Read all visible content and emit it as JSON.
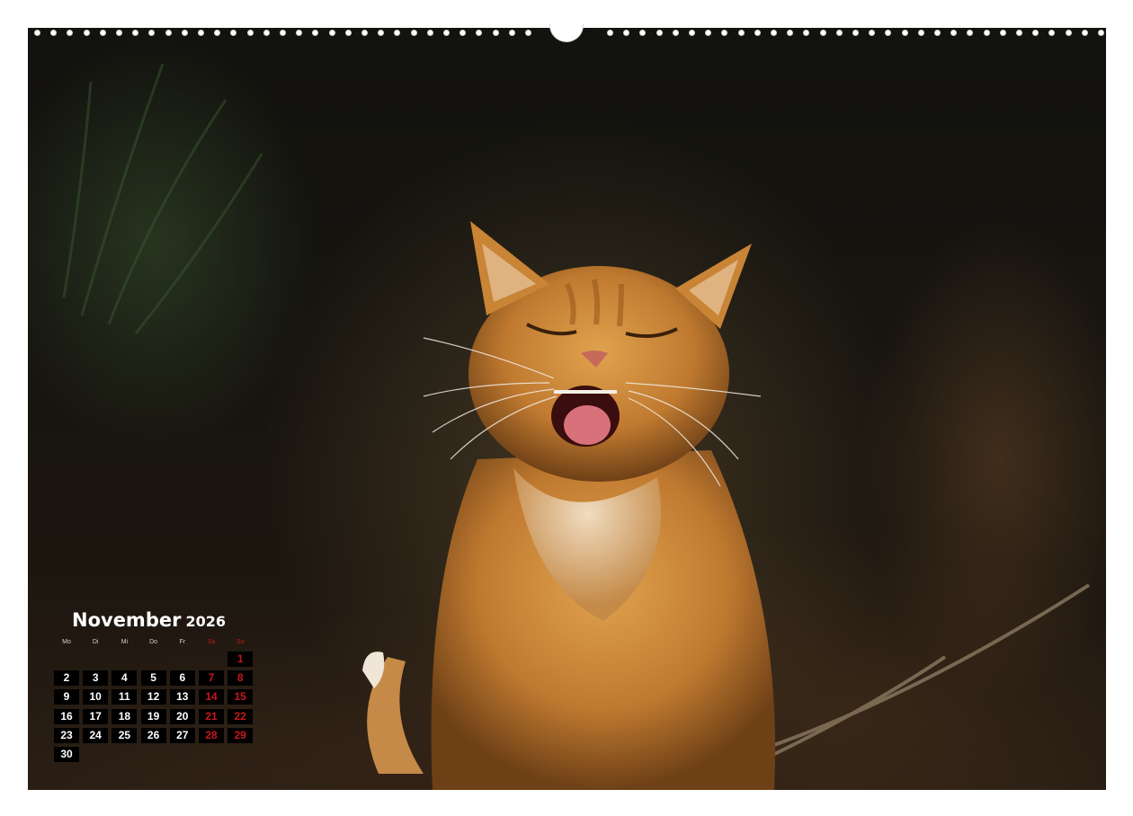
{
  "calendar": {
    "month": "November",
    "year": "2026",
    "weekdays": [
      "Mo",
      "Di",
      "Mi",
      "Do",
      "Fr",
      "Sa",
      "So"
    ],
    "first_weekday_index": 6,
    "days_in_month": 30
  },
  "colors": {
    "weekday_text": "#ffffff",
    "weekend_text": "#c8161c",
    "cell_background": "#000000"
  },
  "image": {
    "subject": "laughing-orange-tabby-cat-photo"
  }
}
